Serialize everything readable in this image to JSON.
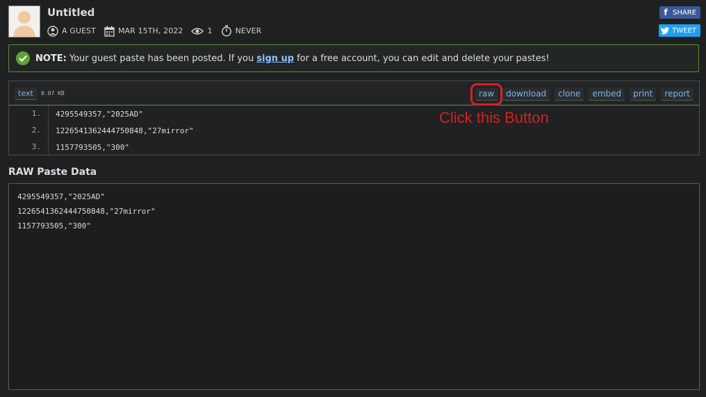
{
  "header": {
    "title": "Untitled",
    "author": "A GUEST",
    "date": "MAR 15TH, 2022",
    "views": "1",
    "expiry": "NEVER"
  },
  "social": {
    "share_label": "SHARE",
    "tweet_label": "TWEET",
    "colors": {
      "facebook": "#3b5998",
      "twitter": "#1da1f2"
    }
  },
  "notice": {
    "prefix": "NOTE:",
    "text_before": "Your guest paste has been posted. If you",
    "link": "sign up",
    "text_after": "for a free account, you can edit and delete your pastes!"
  },
  "paste": {
    "syntax": "text",
    "size": "0.07 KB",
    "buttons": [
      "raw",
      "download",
      "clone",
      "embed",
      "print",
      "report"
    ],
    "lines": [
      {
        "num": "1.",
        "code": "4295549357,\"2025AD\""
      },
      {
        "num": "2.",
        "code": "1226541362444750848,\"27mirror\""
      },
      {
        "num": "3.",
        "code": "1157793505,\"300\""
      }
    ]
  },
  "annotation": {
    "text": "Click this Button",
    "color": "#d42222"
  },
  "raw": {
    "title": "RAW Paste Data",
    "lines": [
      "4295549357,\"2025AD\"",
      "1226541362444750848,\"27mirror\"",
      "1157793505,\"300\""
    ]
  }
}
